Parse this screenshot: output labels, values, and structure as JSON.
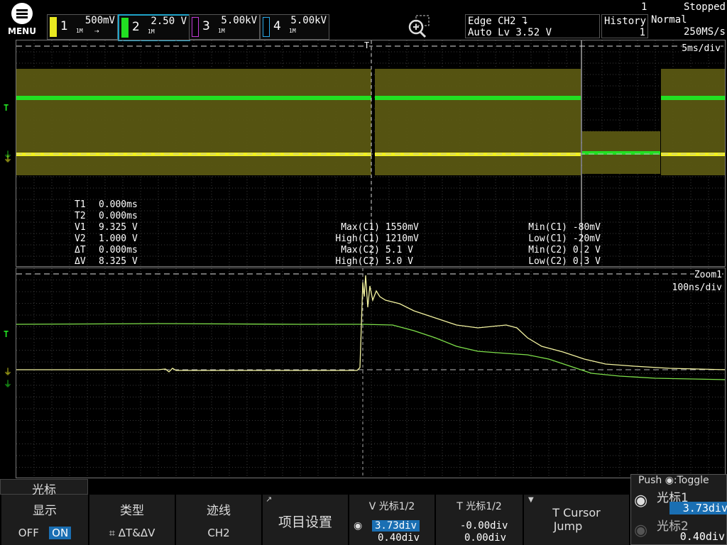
{
  "header": {
    "menu_label": "MENU",
    "channels": [
      {
        "num": "1",
        "scale": "500mV",
        "coupling": "1M",
        "color": "#e8e820",
        "active": false
      },
      {
        "num": "2",
        "scale": "2.50 V",
        "coupling": "1M",
        "color": "#22e022",
        "active": true
      },
      {
        "num": "3",
        "scale": "5.00kV",
        "coupling": "1M",
        "color": "#c23ad8",
        "active": false
      },
      {
        "num": "4",
        "scale": "5.00kV",
        "coupling": "1M",
        "color": "#2aa8e8",
        "active": false
      }
    ],
    "trigger": {
      "line1": "Edge CH2 ⮧",
      "line2": "Auto Lv 3.52 V"
    },
    "history": {
      "label": "History",
      "value": "1"
    },
    "status": {
      "count": "1",
      "state": "Stopped",
      "mode": "Normal",
      "rate": "250MS/s"
    }
  },
  "main_view": {
    "timebase": "5ms/div",
    "trigger_marker": "T"
  },
  "zoom_view": {
    "label": "Zoom1",
    "timebase": "100ns/div"
  },
  "cursor_readout": [
    {
      "label": "T1",
      "value": "0.000ms"
    },
    {
      "label": "T2",
      "value": "0.000ms"
    },
    {
      "label": "V1",
      "value": "9.325 V"
    },
    {
      "label": "V2",
      "value": "1.000 V"
    },
    {
      "label": "ΔT",
      "value": "0.000ms"
    },
    {
      "label": "ΔV",
      "value": "8.325 V"
    }
  ],
  "measurements_left": [
    {
      "label": "Max(C1)",
      "value": "1550mV"
    },
    {
      "label": "High(C1)",
      "value": "1210mV"
    },
    {
      "label": "Max(C2)",
      "value": "5.1 V"
    },
    {
      "label": "High(C2)",
      "value": "5.0 V"
    }
  ],
  "measurements_right": [
    {
      "label": "Min(C1)",
      "value": "-80mV"
    },
    {
      "label": "Low(C1)",
      "value": "-20mV"
    },
    {
      "label": "Min(C2)",
      "value": "0.2 V"
    },
    {
      "label": "Low(C2)",
      "value": "0.3 V"
    }
  ],
  "bottom_menu": {
    "title": "光标",
    "display": {
      "label": "显示",
      "off": "OFF",
      "on": "ON"
    },
    "type": {
      "label": "类型",
      "value": "⌗ ΔT&ΔV"
    },
    "trace": {
      "label": "迹线",
      "value": "CH2"
    },
    "settings": {
      "label": "项目设置"
    },
    "v_cursor": {
      "label": "V 光标1/2",
      "v1": "3.73div",
      "v2": "0.40div"
    },
    "t_cursor": {
      "label": "T 光标1/2",
      "v1": "-0.00div",
      "v2": "0.00div"
    },
    "jump": {
      "label1": "T Cursor",
      "label2": "Jump"
    }
  },
  "knob_panel": {
    "title": "Push",
    "toggle": ":Toggle",
    "cursor1_label": "光标1",
    "cursor1_value": "3.73div",
    "cursor2_label": "光标2",
    "cursor2_value": "0.40div"
  }
}
